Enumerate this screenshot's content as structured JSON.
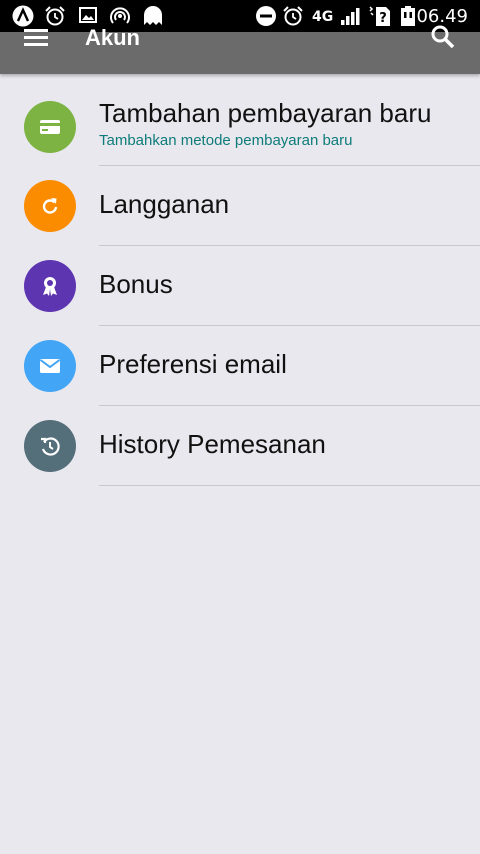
{
  "status_bar": {
    "time": "06.49",
    "network": "4G",
    "icons": [
      "app-a-icon",
      "alarm-icon",
      "image-icon",
      "hotspot-icon",
      "ghost-icon",
      "dnd-icon",
      "alarm-icon",
      "signal-icon",
      "no-sim-icon",
      "battery-icon"
    ]
  },
  "app_bar": {
    "title": "Akun",
    "menu_icon": "menu-icon",
    "search_icon": "search-icon"
  },
  "items": [
    {
      "label": "Tambahan pembayaran baru",
      "sublabel": "Tambahkan metode pembayaran baru",
      "icon": "credit-card-icon",
      "color": "#7cb342"
    },
    {
      "label": "Langganan",
      "icon": "refresh-icon",
      "color": "#fb8c00"
    },
    {
      "label": "Bonus",
      "icon": "award-icon",
      "color": "#5e35b1"
    },
    {
      "label": "Preferensi email",
      "icon": "mail-icon",
      "color": "#42a5f5"
    },
    {
      "label": "History Pemesanan",
      "icon": "history-icon",
      "color": "#546e7a"
    }
  ],
  "colors": {
    "app_bar": "#6b6b6b",
    "background": "#e9e8ee",
    "sublabel": "#0f7c7a"
  }
}
